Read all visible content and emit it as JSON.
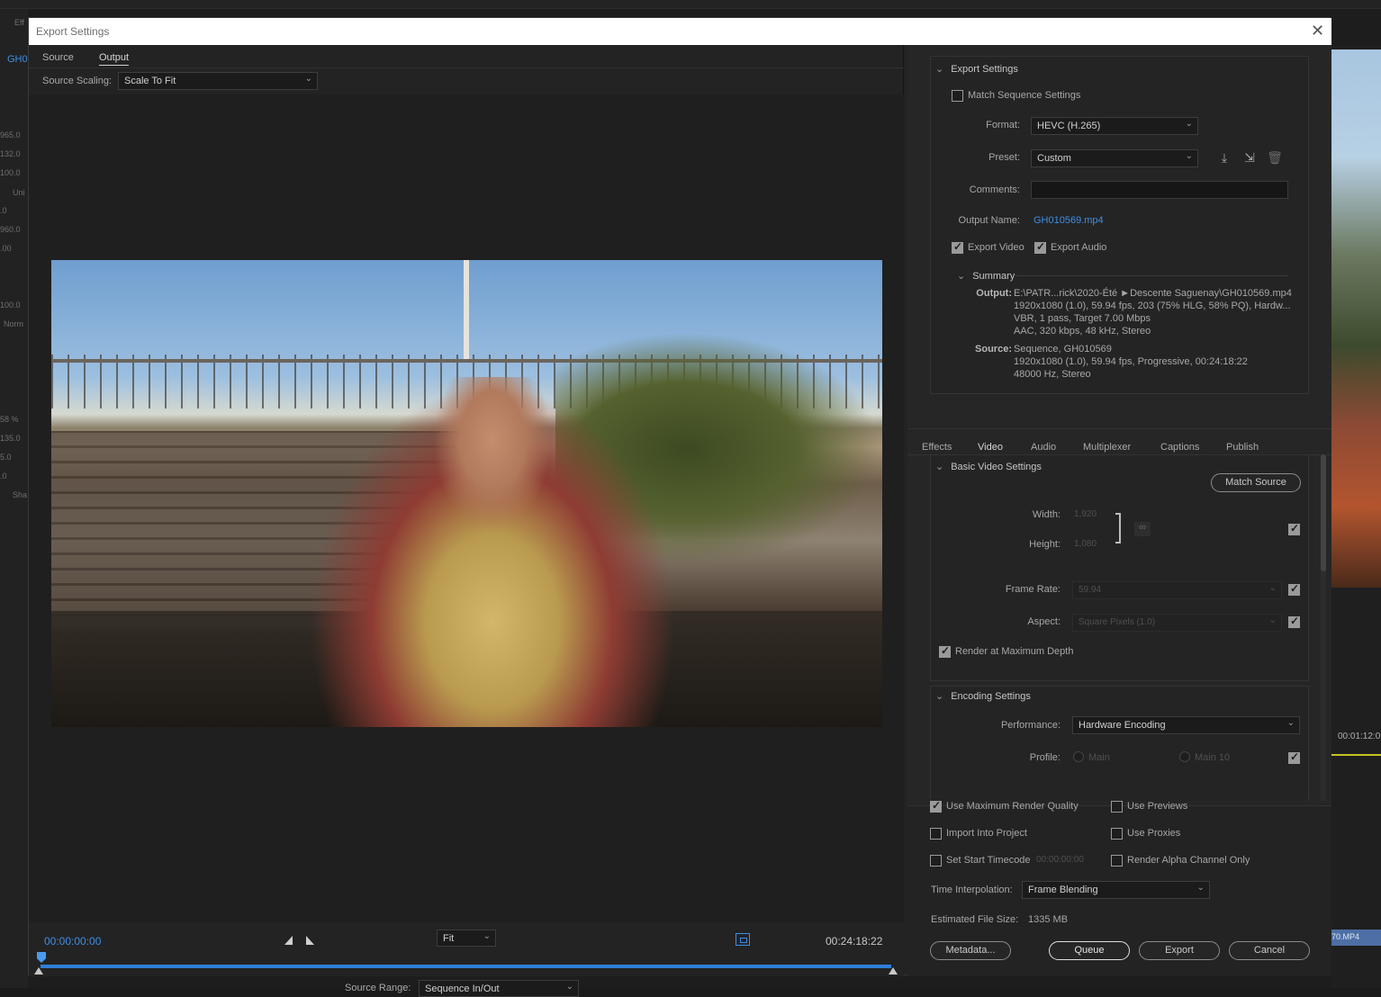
{
  "background_app": {
    "left_values": [
      "965.0",
      "132.0",
      "100.0",
      "Uni",
      ".0",
      "960.0",
      ".00",
      "100.0",
      "Norm",
      "58 %",
      "135.0",
      "5.0",
      ".0",
      "Sha"
    ],
    "left_tag": "GH0",
    "left_tag2": "Eff",
    "right_timecode": "00:01:12:0",
    "right_clip": "70.MP4"
  },
  "dialog": {
    "title": "Export Settings"
  },
  "left": {
    "tabs": [
      "Source",
      "Output"
    ],
    "active_tab": "Output",
    "source_scaling_label": "Source Scaling:",
    "source_scaling_value": "Scale To Fit",
    "timecode_start": "00:00:00:00",
    "timecode_end": "00:24:18:22",
    "zoom_value": "Fit",
    "source_range_label": "Source Range:",
    "source_range_value": "Sequence In/Out"
  },
  "export_settings": {
    "header": "Export Settings",
    "match_sequence": {
      "label": "Match Sequence Settings",
      "checked": false
    },
    "format_label": "Format:",
    "format_value": "HEVC (H.265)",
    "preset_label": "Preset:",
    "preset_value": "Custom",
    "comments_label": "Comments:",
    "comments_value": "",
    "output_name_label": "Output Name:",
    "output_name_value": "GH010569.mp4",
    "export_video": {
      "label": "Export Video",
      "checked": true
    },
    "export_audio": {
      "label": "Export Audio",
      "checked": true
    },
    "summary_header": "Summary",
    "summary_output_key": "Output:",
    "summary_output_lines": [
      "E:\\PATR...rick\\2020-Été ►Descente Saguenay\\GH010569.mp4",
      "1920x1080 (1.0), 59.94 fps, 203 (75% HLG, 58% PQ), Hardw...",
      "VBR, 1 pass, Target 7.00 Mbps",
      "AAC, 320 kbps, 48 kHz, Stereo"
    ],
    "summary_source_key": "Source:",
    "summary_source_lines": [
      "Sequence, GH010569",
      "1920x1080 (1.0), 59.94 fps, Progressive, 00:24:18:22",
      "48000 Hz, Stereo"
    ]
  },
  "settings_tabs": [
    "Effects",
    "Video",
    "Audio",
    "Multiplexer",
    "Captions",
    "Publish"
  ],
  "active_settings_tab": "Video",
  "basic_video": {
    "header": "Basic Video Settings",
    "match_source": "Match Source",
    "width_label": "Width:",
    "width_value": "1,920",
    "height_label": "Height:",
    "height_value": "1,080",
    "frame_rate_label": "Frame Rate:",
    "frame_rate_value": "59.94",
    "aspect_label": "Aspect:",
    "aspect_value": "Square Pixels (1.0)",
    "render_max_depth": {
      "label": "Render at Maximum Depth",
      "checked": true
    }
  },
  "encoding": {
    "header": "Encoding Settings",
    "performance_label": "Performance:",
    "performance_value": "Hardware Encoding",
    "profile_label": "Profile:",
    "profile_main": "Main",
    "profile_main10": "Main 10"
  },
  "bottom": {
    "use_max_render_quality": {
      "label": "Use Maximum Render Quality",
      "checked": true
    },
    "use_previews": {
      "label": "Use Previews",
      "checked": false
    },
    "import_into_project": {
      "label": "Import Into Project",
      "checked": false
    },
    "use_proxies": {
      "label": "Use Proxies",
      "checked": false
    },
    "set_start_timecode": {
      "label": "Set Start Timecode",
      "checked": false,
      "value": "00:00:00:00"
    },
    "render_alpha_only": {
      "label": "Render Alpha Channel Only",
      "checked": false
    },
    "time_interpolation_label": "Time Interpolation:",
    "time_interpolation_value": "Frame Blending",
    "estimated_size_label": "Estimated File Size:",
    "estimated_size_value": "1335 MB",
    "buttons": {
      "metadata": "Metadata...",
      "queue": "Queue",
      "export": "Export",
      "cancel": "Cancel"
    }
  },
  "colors": {
    "accent": "#3d8ee6",
    "track": "#2f7fd8",
    "panel": "#262626"
  }
}
